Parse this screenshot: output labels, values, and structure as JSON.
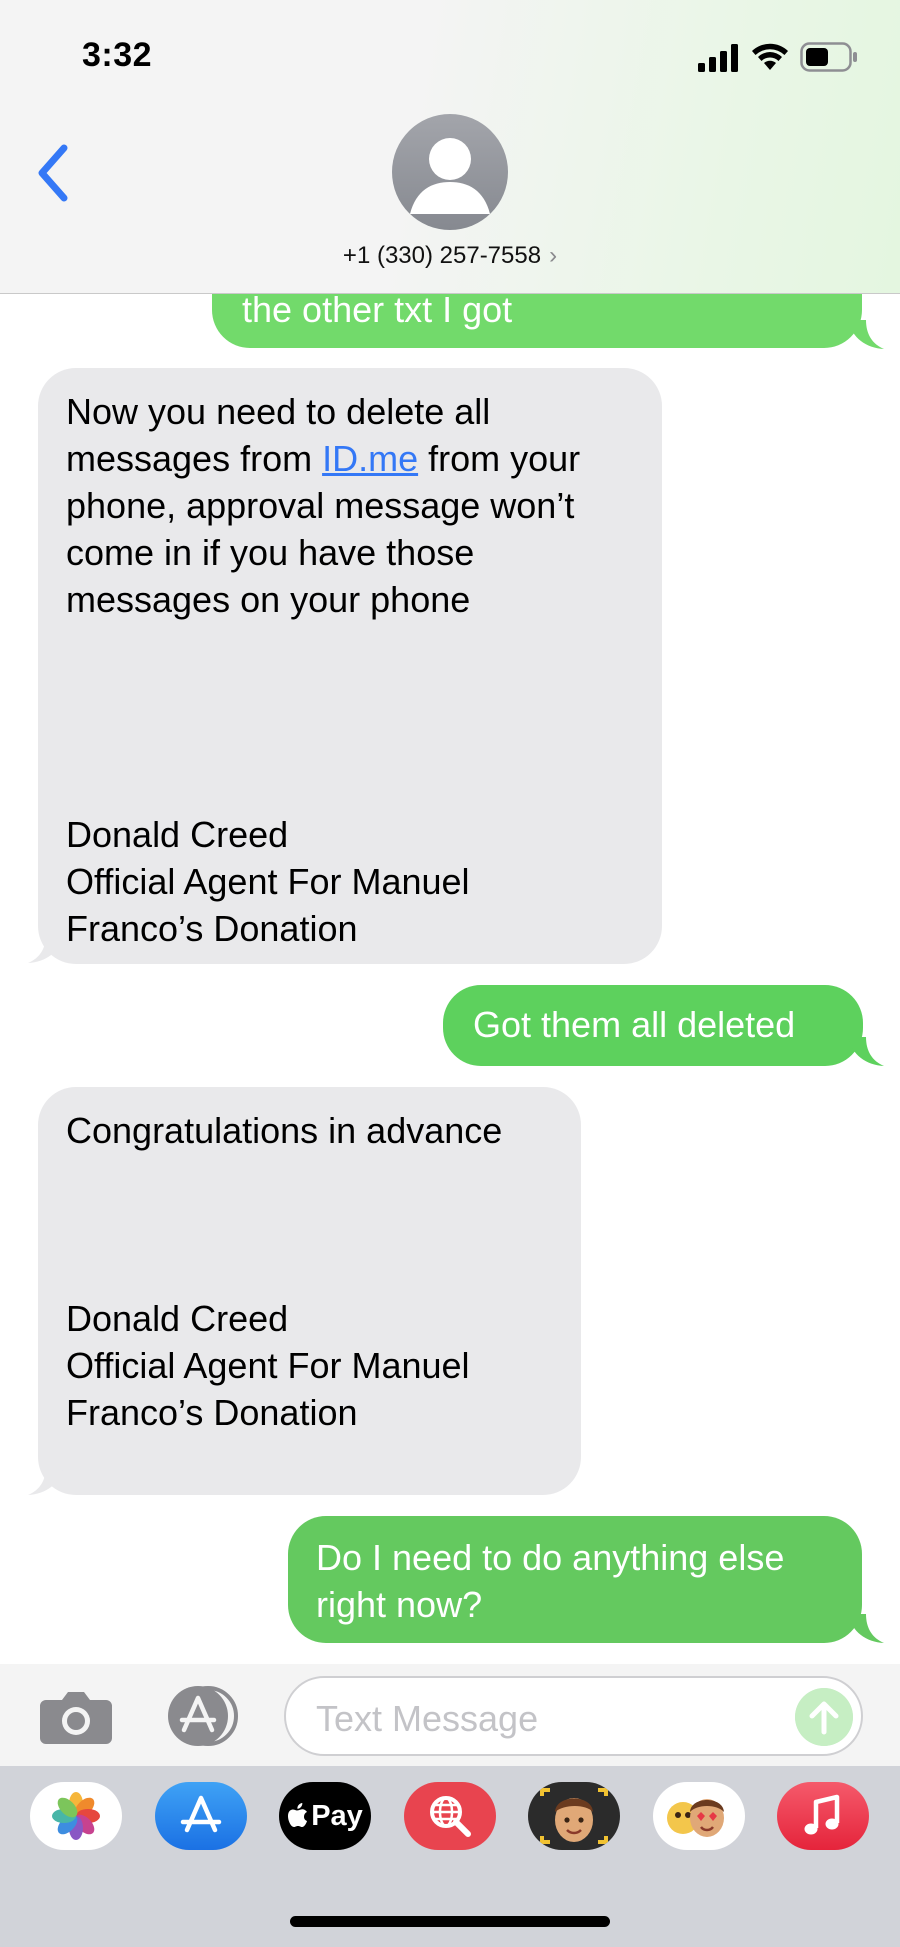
{
  "status_bar": {
    "time": "3:32"
  },
  "header": {
    "contact_number": "+1 (330) 257-7558",
    "chevron": "›"
  },
  "messages": [
    {
      "direction": "outgoing",
      "lines": [
        "the other txt I got"
      ]
    },
    {
      "direction": "incoming",
      "lines": [
        "Now you need to delete all",
        "from your",
        "phone, approval message won’t",
        "come in if you have those",
        "messages on your phone",
        "Donald Creed",
        "Official Agent For Manuel",
        "Franco’s Donation"
      ],
      "line2_prefix": "messages from ",
      "link": "ID.me"
    },
    {
      "direction": "outgoing",
      "lines": [
        "Got them all deleted"
      ]
    },
    {
      "direction": "incoming",
      "lines": [
        "Congratulations in advance",
        "Donald Creed",
        "Official Agent For Manuel",
        "Franco’s Donation"
      ]
    },
    {
      "direction": "outgoing",
      "lines": [
        "Do I need to do anything else",
        "right now?"
      ]
    }
  ],
  "input": {
    "placeholder": "Text Message"
  },
  "app_drawer": {
    "apps": [
      "Photos",
      "App Store",
      "Apple Pay",
      "Search",
      "Memoji",
      "Memoji Stickers",
      "Music"
    ],
    "applepay_label": "Pay"
  },
  "colors": {
    "outgoing_bubble": "#5dd15d",
    "incoming_bubble": "#e9e9eb",
    "link": "#3478f6",
    "back_chevron": "#3478f6"
  }
}
